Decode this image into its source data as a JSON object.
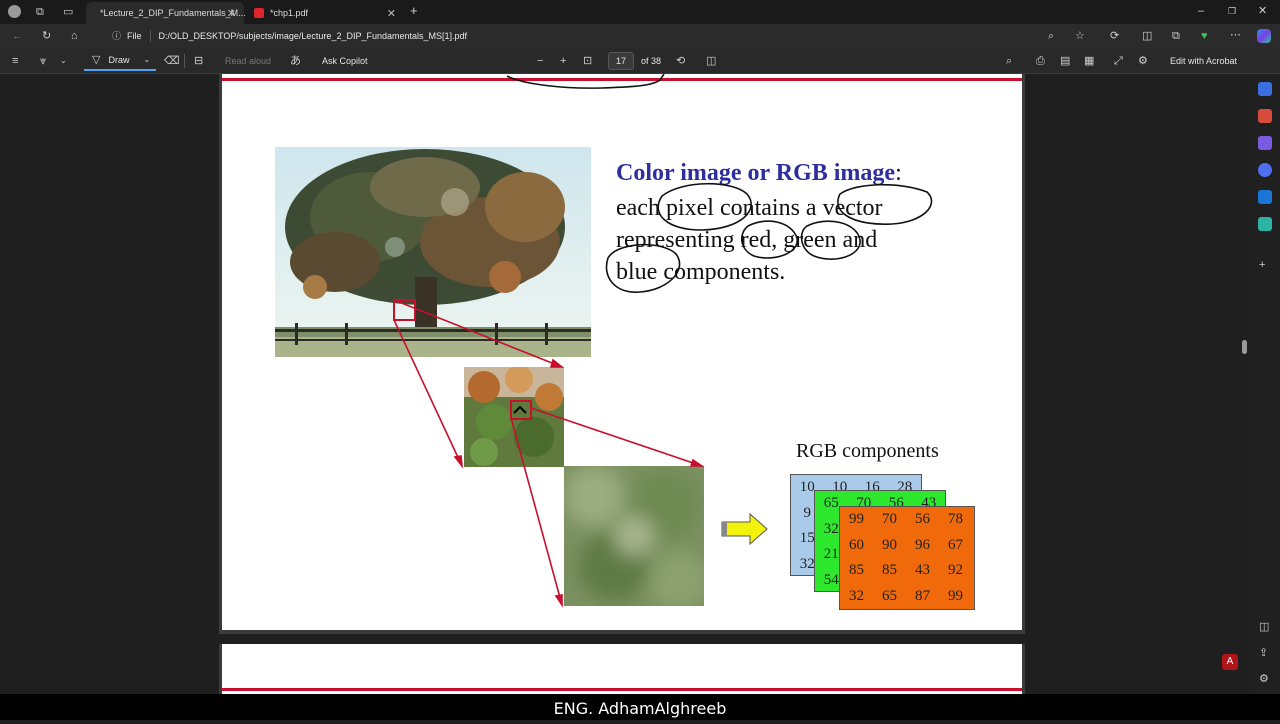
{
  "browser": {
    "tabs": [
      {
        "label": "*Lecture_2_DIP_Fundamentals_M..."
      },
      {
        "label": "*chp1.pdf"
      }
    ],
    "file_label": "File",
    "url": "D:/OLD_DESKTOP/subjects/image/Lecture_2_DIP_Fundamentals_MS[1].pdf"
  },
  "toolbar": {
    "draw_label": "Draw",
    "read_aloud_label": "Read aloud",
    "ask_copilot_label": "Ask Copilot",
    "page_number": "17",
    "page_total": "of 38",
    "edit_acrobat_label": "Edit with Acrobat"
  },
  "slide": {
    "title": "Color image or RGB image",
    "title_colon": ":",
    "body_lines": [
      "each pixel contains a vector",
      "representing red, green and",
      "blue components."
    ],
    "rgb_title": "RGB components",
    "blue_matrix": [
      [
        "10",
        "10",
        "16",
        "28"
      ],
      [
        "9",
        "",
        "",
        ""
      ],
      [
        "15",
        "",
        "",
        ""
      ],
      [
        "32",
        "",
        "",
        ""
      ]
    ],
    "green_matrix": [
      [
        "65",
        "70",
        "56",
        "43"
      ],
      [
        "32",
        "",
        "",
        ""
      ],
      [
        "21",
        "",
        "",
        ""
      ],
      [
        "54",
        "",
        "",
        ""
      ]
    ],
    "orange_matrix": [
      [
        "99",
        "70",
        "56",
        "78"
      ],
      [
        "60",
        "90",
        "96",
        "67"
      ],
      [
        "85",
        "85",
        "43",
        "92"
      ],
      [
        "32",
        "65",
        "87",
        "99"
      ]
    ],
    "colors": {
      "title": "#2e2e9f",
      "blue_layer": "#a9cbe9",
      "green_layer": "#2ee82e",
      "orange_layer": "#f06a0c",
      "red_line": "#c8102e"
    }
  },
  "caption": "ENG. AdhamAlghreeb"
}
